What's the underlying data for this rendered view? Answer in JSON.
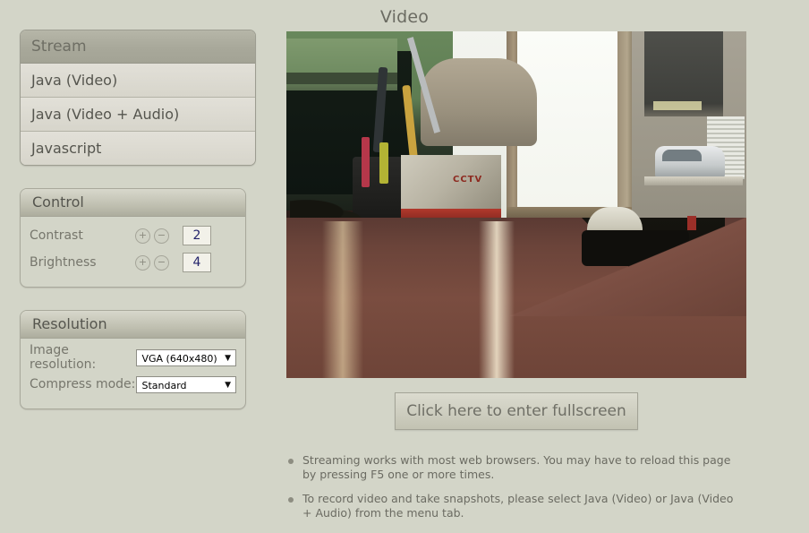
{
  "page": {
    "title": "Video"
  },
  "stream_menu": {
    "header": "Stream",
    "items": [
      {
        "label": "Java (Video)"
      },
      {
        "label": "Java (Video + Audio)"
      },
      {
        "label": "Javascript"
      }
    ]
  },
  "control": {
    "header": "Control",
    "increase_label": "+",
    "decrease_label": "−",
    "rows": [
      {
        "label": "Contrast",
        "value": "2"
      },
      {
        "label": "Brightness",
        "value": "4"
      }
    ]
  },
  "resolution": {
    "header": "Resolution",
    "arrow": "▼",
    "rows": [
      {
        "label": "Image resolution:",
        "value": "VGA (640x480)"
      },
      {
        "label": "Compress mode:",
        "value": "Standard"
      }
    ]
  },
  "video": {
    "alt": "live-camera-stream",
    "overlay_text": "CCTV"
  },
  "fullscreen": {
    "label": "Click here to enter fullscreen"
  },
  "notes": [
    {
      "text": "Streaming works with most web browsers. You may have to reload this page by pressing F5 one or more times."
    },
    {
      "text": "To record video and take snapshots, please select Java (Video) or Java (Video + Audio) from the menu tab."
    }
  ],
  "colors": {
    "background": "#d3d5c8",
    "panel_header": "#adad9e",
    "menu_header": "#a8a89a",
    "text": "#6b6b62",
    "value_text": "#23236b"
  }
}
